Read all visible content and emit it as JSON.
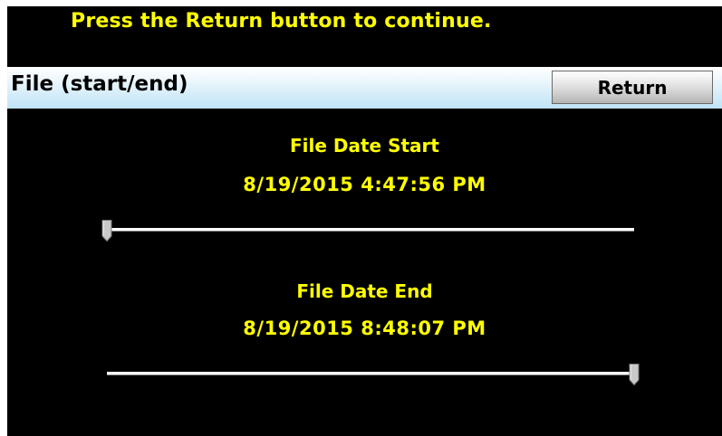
{
  "prompt_text": "Press the Return button to continue.",
  "header": {
    "title": "File (start/end)",
    "return_label": "Return"
  },
  "start": {
    "title": "File Date Start",
    "value": "8/19/2015 4:47:56 PM",
    "slider_position": 0.0
  },
  "end": {
    "title": "File Date End",
    "value": "8/19/2015 8:48:07 PM",
    "slider_position": 1.0
  },
  "colors": {
    "background": "#000000",
    "text_accent": "#ffff00",
    "header_gradient_top": "#ffffff",
    "header_gradient_bottom": "#bfe3f6",
    "button_face": "#d6d6d6"
  }
}
